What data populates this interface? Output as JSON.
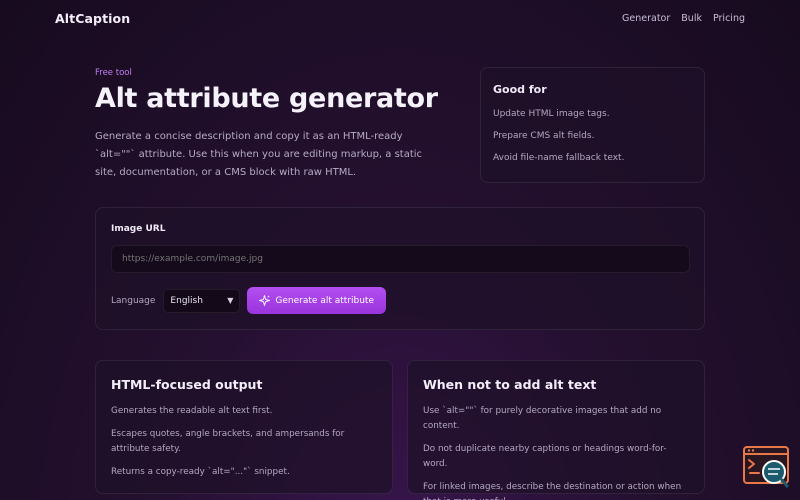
{
  "nav": {
    "logo": "AltCaption",
    "links": [
      "Generator",
      "Bulk",
      "Pricing"
    ]
  },
  "hero": {
    "eyebrow": "Free tool",
    "title": "Alt attribute generator",
    "description": "Generate a concise description and copy it as an HTML-ready `alt=\"\"` attribute. Use this when you are editing markup, a static site, documentation, or a CMS block with raw HTML."
  },
  "good_for": {
    "title": "Good for",
    "items": [
      "Update HTML image tags.",
      "Prepare CMS alt fields.",
      "Avoid file-name fallback text."
    ]
  },
  "form": {
    "url_label": "Image URL",
    "url_placeholder": "https://example.com/image.jpg",
    "language_label": "Language",
    "language_value": "English",
    "generate_label": "Generate alt attribute"
  },
  "html_output": {
    "title": "HTML-focused output",
    "items": [
      "Generates the readable alt text first.",
      "Escapes quotes, angle brackets, and ampersands for attribute safety.",
      "Returns a copy-ready `alt=\"...\"` snippet."
    ]
  },
  "when_not": {
    "title": "When not to add alt text",
    "items": [
      "Use `alt=\"\"` for purely decorative images that add no content.",
      "Do not duplicate nearby captions or headings word-for-word.",
      "For linked images, describe the destination or action when that is more useful."
    ]
  },
  "colors": {
    "accent": "#a83fe8",
    "eyebrow": "#c07ef0",
    "background": "#1d0d27",
    "widget_orange": "#e7784a",
    "widget_teal": "#1c5a6e"
  },
  "icons": {
    "generate": "sparkle-icon",
    "select": "chevron-down-icon",
    "widget": "terminal-search-icon"
  }
}
